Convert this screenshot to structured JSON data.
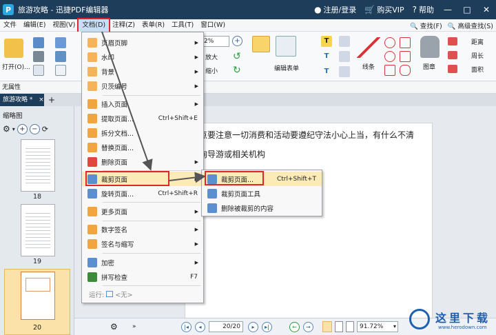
{
  "window": {
    "title": "旅游攻略 - 迅捷PDF编辑器",
    "logo_letter": "P",
    "register_label": "注册/登录",
    "buy_label": "购买VIP",
    "help_label": "帮助"
  },
  "menubar": {
    "items": [
      "文件",
      "编辑(E)",
      "视图(V)",
      "文档(D)",
      "注释(Z)",
      "表单(R)",
      "工具(T)",
      "窗口(W)"
    ],
    "find_label": "查找(F)",
    "advanced_find_label": "高级查找(S)"
  },
  "toolbar": {
    "open_label": "打开(O)...",
    "zoom_value": "2%",
    "zoom_in_label": "放大",
    "zoom_out_label": "缩小",
    "edit_form_label": "编辑表单",
    "line_label": "线条",
    "stamp_label": "图章",
    "distance_label": "距离",
    "perimeter_label": "周长",
    "area_label": "面积"
  },
  "propbar": {
    "label": "无属性"
  },
  "tabs": [
    {
      "label": "旅游攻略 *"
    }
  ],
  "thumbnails": {
    "title": "缩略图",
    "pages": [
      "18",
      "19",
      "20"
    ],
    "selected_page": "20"
  },
  "document": {
    "line1": "点要注意一切消费和活动要遵纪守法小心上当，有什么不清",
    "line2": "询导游或相关机构"
  },
  "statusbar": {
    "page_value": "20/20",
    "zoom_value": "91.72%"
  },
  "doc_menu": {
    "items": [
      {
        "label": "页眉页脚",
        "shortcut": "",
        "arrow": "▶"
      },
      {
        "label": "水印",
        "shortcut": "",
        "arrow": "▶"
      },
      {
        "label": "背景",
        "shortcut": "",
        "arrow": "▶"
      },
      {
        "label": "贝茨编号",
        "shortcut": "",
        "arrow": "▶"
      },
      {
        "label": "插入页面",
        "shortcut": "",
        "arrow": "▶"
      },
      {
        "label": "提取页面...",
        "shortcut": "Ctrl+Shift+E",
        "arrow": ""
      },
      {
        "label": "拆分文档...",
        "shortcut": "",
        "arrow": ""
      },
      {
        "label": "替换页面...",
        "shortcut": "",
        "arrow": ""
      },
      {
        "label": "删除页面",
        "shortcut": "",
        "arrow": "▶"
      },
      {
        "label": "裁剪页面",
        "shortcut": "",
        "arrow": "▶"
      },
      {
        "label": "旋转页面...",
        "shortcut": "Ctrl+Shift+R",
        "arrow": ""
      },
      {
        "label": "更多页面",
        "shortcut": "",
        "arrow": "▶"
      },
      {
        "label": "数字签名",
        "shortcut": "",
        "arrow": "▶"
      },
      {
        "label": "签名与缩写",
        "shortcut": "",
        "arrow": "▶"
      },
      {
        "label": "加密",
        "shortcut": "",
        "arrow": "▶"
      },
      {
        "label": "拼写检查",
        "shortcut": "F7",
        "arrow": ""
      },
      {
        "label": "运行:",
        "shortcut": "",
        "arrow": ""
      }
    ],
    "run_value": "<无>"
  },
  "crop_submenu": {
    "items": [
      {
        "label": "裁剪页面...",
        "shortcut": "Ctrl+Shift+T"
      },
      {
        "label": "裁剪页面工具",
        "shortcut": ""
      },
      {
        "label": "删除被裁剪的内容",
        "shortcut": ""
      }
    ]
  },
  "watermark_text": "这里下载",
  "watermark_url": "www.herodown.com",
  "colors": {
    "titlebar": "#1d3d5a",
    "highlight": "#fcebb6",
    "annotation_red": "#e0262d"
  }
}
